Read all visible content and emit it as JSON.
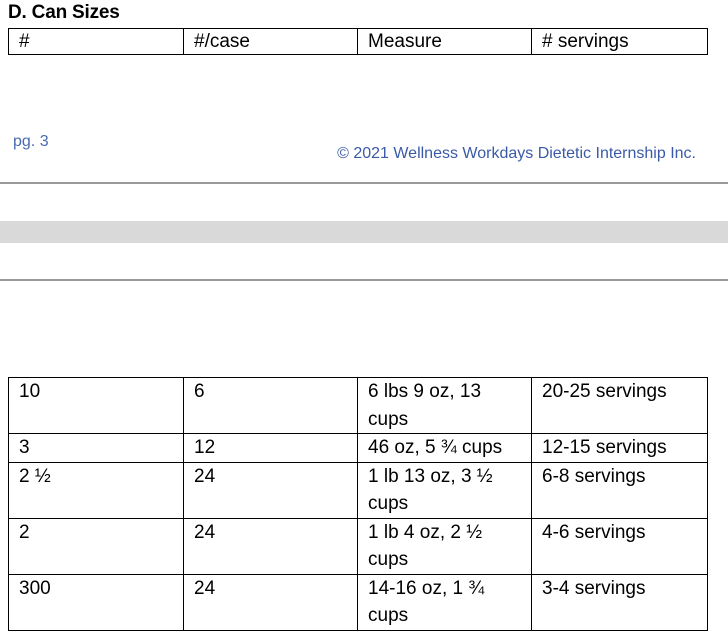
{
  "section_title": "D. Can Sizes",
  "header": [
    "#",
    "#/case",
    "Measure",
    "# servings"
  ],
  "footer": {
    "page": "pg. 3",
    "copyright": "© 2021 Wellness Workdays Dietetic Internship Inc."
  },
  "rows": [
    {
      "num": "10",
      "per_case": "6",
      "measure": "6 lbs 9 oz, 13 cups",
      "servings": "20-25 servings"
    },
    {
      "num": "3",
      "per_case": "12",
      "measure": "46 oz, 5 ¾ cups",
      "servings": "12-15 servings"
    },
    {
      "num": "2 ½",
      "per_case": "24",
      "measure": "1 lb 13 oz, 3 ½ cups",
      "servings": "6-8 servings"
    },
    {
      "num": "2",
      "per_case": "24",
      "measure": "1 lb 4 oz, 2 ½ cups",
      "servings": "4-6 servings"
    },
    {
      "num": "300",
      "per_case": "24",
      "measure": "14-16 oz, 1 ¾ cups",
      "servings": "3-4 servings"
    }
  ]
}
